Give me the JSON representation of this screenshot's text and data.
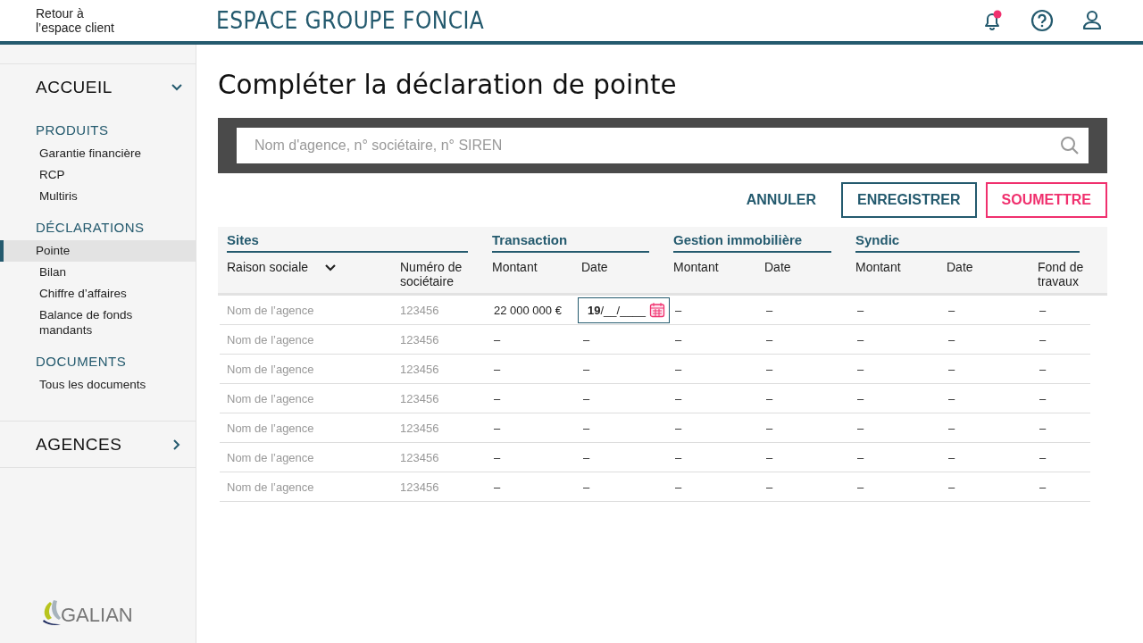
{
  "header": {
    "back_link": "Retour à\nl’espace client",
    "title": "ESPACE GROUPE FONCIA",
    "notification_unread": true
  },
  "sidebar": {
    "home": {
      "label": "ACCUEIL",
      "expanded": true
    },
    "sections": [
      {
        "title": "PRODUITS",
        "items": [
          {
            "label": "Garantie financière",
            "selected": false
          },
          {
            "label": "RCP",
            "selected": false
          },
          {
            "label": "Multiris",
            "selected": false
          }
        ]
      },
      {
        "title": "DÉCLARATIONS",
        "items": [
          {
            "label": "Pointe",
            "selected": true
          },
          {
            "label": "Bilan",
            "selected": false
          },
          {
            "label": "Chiffre d’affaires",
            "selected": false
          },
          {
            "label": "Balance de fonds mandants",
            "selected": false
          }
        ]
      },
      {
        "title": "DOCUMENTS",
        "items": [
          {
            "label": "Tous les documents",
            "selected": false
          }
        ]
      }
    ],
    "agencies": {
      "label": "AGENCES",
      "expanded": false
    },
    "logo": "GALIAN"
  },
  "page_title": "Compléter la déclaration de pointe",
  "search": {
    "placeholder": "Nom d'agence, n° sociétaire, n° SIREN"
  },
  "buttons": [
    {
      "label": "ANNULER",
      "kind": "text"
    },
    {
      "label": "ENREGISTRER",
      "kind": "outline"
    },
    {
      "label": "SOUMETTRE",
      "kind": "primary"
    }
  ],
  "table": {
    "groups": [
      {
        "label": "Sites"
      },
      {
        "label": "Transaction"
      },
      {
        "label": "Gestion immobilière"
      },
      {
        "label": "Syndic"
      }
    ],
    "columns": [
      {
        "label": "Raison sociale",
        "sortable": true
      },
      {
        "label": "Numéro de sociétaire",
        "sortable": false
      },
      {
        "label": "Montant",
        "sortable": false
      },
      {
        "label": "Date",
        "sortable": false
      },
      {
        "label": "Montant",
        "sortable": false
      },
      {
        "label": "Date",
        "sortable": false
      },
      {
        "label": "Montant",
        "sortable": false
      },
      {
        "label": "Date",
        "sortable": false
      },
      {
        "label": "Fond de travaux",
        "sortable": false
      }
    ],
    "rows": [
      {
        "cells": [
          {
            "kind": "muted",
            "text": "Nom de l’agence"
          },
          {
            "kind": "muted",
            "text": "123456"
          },
          {
            "kind": "text",
            "text": "22 000 000 €"
          },
          {
            "kind": "date_field",
            "text": "**19**/__/____"
          },
          {
            "kind": "text",
            "text": "–"
          },
          {
            "kind": "text",
            "text": "–"
          },
          {
            "kind": "text",
            "text": "–"
          },
          {
            "kind": "text",
            "text": "–"
          },
          {
            "kind": "text",
            "text": "–"
          }
        ]
      },
      {
        "cells": [
          {
            "kind": "muted",
            "text": "Nom de l’agence"
          },
          {
            "kind": "muted",
            "text": "123456"
          },
          {
            "kind": "text",
            "text": "–"
          },
          {
            "kind": "text",
            "text": "–"
          },
          {
            "kind": "text",
            "text": "–"
          },
          {
            "kind": "text",
            "text": "–"
          },
          {
            "kind": "text",
            "text": "–"
          },
          {
            "kind": "text",
            "text": "–"
          },
          {
            "kind": "text",
            "text": "–"
          }
        ]
      },
      {
        "cells": [
          {
            "kind": "muted",
            "text": "Nom de l’agence"
          },
          {
            "kind": "muted",
            "text": "123456"
          },
          {
            "kind": "text",
            "text": "–"
          },
          {
            "kind": "text",
            "text": "–"
          },
          {
            "kind": "text",
            "text": "–"
          },
          {
            "kind": "text",
            "text": "–"
          },
          {
            "kind": "text",
            "text": "–"
          },
          {
            "kind": "text",
            "text": "–"
          },
          {
            "kind": "text",
            "text": "–"
          }
        ]
      },
      {
        "cells": [
          {
            "kind": "muted",
            "text": "Nom de l’agence"
          },
          {
            "kind": "muted",
            "text": "123456"
          },
          {
            "kind": "text",
            "text": "–"
          },
          {
            "kind": "text",
            "text": "–"
          },
          {
            "kind": "text",
            "text": "–"
          },
          {
            "kind": "text",
            "text": "–"
          },
          {
            "kind": "text",
            "text": "–"
          },
          {
            "kind": "text",
            "text": "–"
          },
          {
            "kind": "text",
            "text": "–"
          }
        ]
      },
      {
        "cells": [
          {
            "kind": "muted",
            "text": "Nom de l’agence"
          },
          {
            "kind": "muted",
            "text": "123456"
          },
          {
            "kind": "text",
            "text": "–"
          },
          {
            "kind": "text",
            "text": "–"
          },
          {
            "kind": "text",
            "text": "–"
          },
          {
            "kind": "text",
            "text": "–"
          },
          {
            "kind": "text",
            "text": "–"
          },
          {
            "kind": "text",
            "text": "–"
          },
          {
            "kind": "text",
            "text": "–"
          }
        ]
      },
      {
        "cells": [
          {
            "kind": "muted",
            "text": "Nom de l’agence"
          },
          {
            "kind": "muted",
            "text": "123456"
          },
          {
            "kind": "text",
            "text": "–"
          },
          {
            "kind": "text",
            "text": "–"
          },
          {
            "kind": "text",
            "text": "–"
          },
          {
            "kind": "text",
            "text": "–"
          },
          {
            "kind": "text",
            "text": "–"
          },
          {
            "kind": "text",
            "text": "–"
          },
          {
            "kind": "text",
            "text": "–"
          }
        ]
      },
      {
        "cells": [
          {
            "kind": "muted",
            "text": "Nom de l’agence"
          },
          {
            "kind": "muted",
            "text": "123456"
          },
          {
            "kind": "text",
            "text": "–"
          },
          {
            "kind": "text",
            "text": "–"
          },
          {
            "kind": "text",
            "text": "–"
          },
          {
            "kind": "text",
            "text": "–"
          },
          {
            "kind": "text",
            "text": "–"
          },
          {
            "kind": "text",
            "text": "–"
          },
          {
            "kind": "text",
            "text": "–"
          }
        ]
      }
    ]
  }
}
